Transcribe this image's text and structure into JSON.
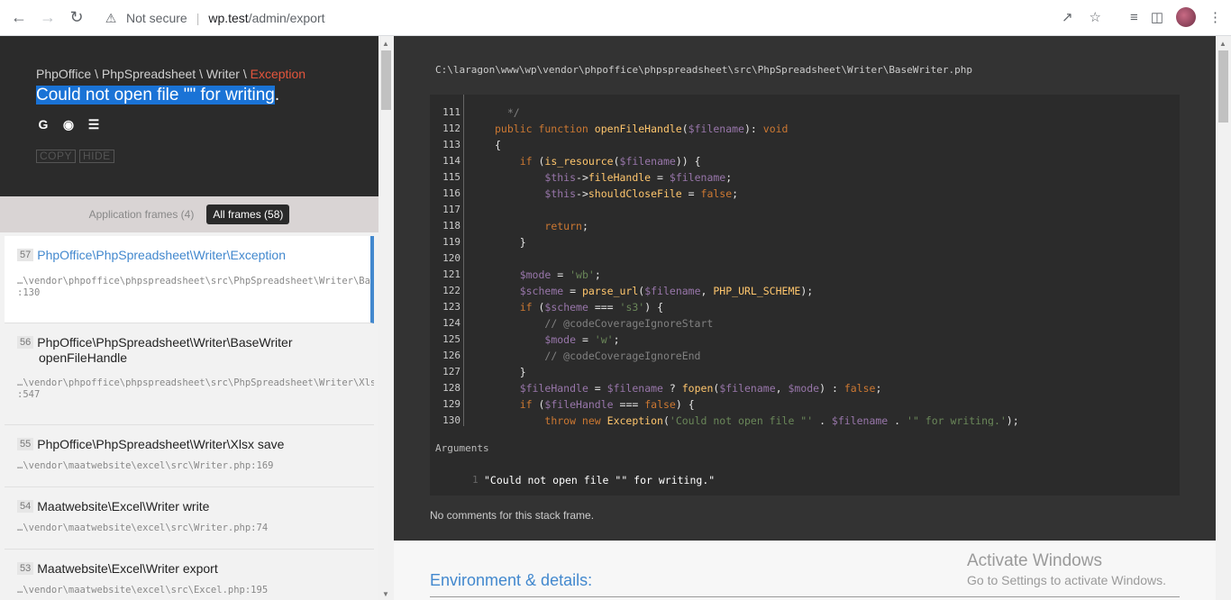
{
  "browser": {
    "not_secure": "Not secure",
    "url_host": "wp.test",
    "url_path": "/admin/export"
  },
  "exception": {
    "class_path": "PhpOffice \\ PhpSpreadsheet \\ Writer \\ ",
    "class_name": "Exception",
    "message_highlight": "Could not open file \"\" for writing",
    "message_tail": ".",
    "copy_label": "COPY",
    "hide_label": "HIDE"
  },
  "tabs": {
    "application": "Application frames (4)",
    "all": "All frames (58)"
  },
  "frames": [
    {
      "no": "57",
      "cls": "PhpOffice\\PhpSpreadsheet\\Writer\\Exception",
      "method": "",
      "file": "…\\vendor\\phpoffice\\phpspreadsheet\\src\\PhpSpreadsheet\\Writer\\BaseWriter.php",
      "line": ":130"
    },
    {
      "no": "56",
      "cls": "PhpOffice\\PhpSpreadsheet\\Writer\\BaseWriter",
      "method": "openFileHandle",
      "file": "…\\vendor\\phpoffice\\phpspreadsheet\\src\\PhpSpreadsheet\\Writer\\Xlsx.php",
      "line": ":547"
    },
    {
      "no": "55",
      "cls": "PhpOffice\\PhpSpreadsheet\\Writer\\Xlsx save",
      "method": "",
      "file": "…\\vendor\\maatwebsite\\excel\\src\\Writer.php:169",
      "line": ""
    },
    {
      "no": "54",
      "cls": "Maatwebsite\\Excel\\Writer write",
      "method": "",
      "file": "…\\vendor\\maatwebsite\\excel\\src\\Writer.php:74",
      "line": ""
    },
    {
      "no": "53",
      "cls": "Maatwebsite\\Excel\\Writer export",
      "method": "",
      "file": "…\\vendor\\maatwebsite\\excel\\src\\Excel.php:195",
      "line": ""
    }
  ],
  "code": {
    "file_path": "C:\\laragon\\www\\wp\\vendor\\phpoffice\\phpspreadsheet\\src\\PhpSpreadsheet\\Writer\\BaseWriter.php",
    "line_numbers": [
      "111",
      "112",
      "113",
      "114",
      "115",
      "116",
      "117",
      "118",
      "119",
      "120",
      "121",
      "122",
      "123",
      "124",
      "125",
      "126",
      "127",
      "128",
      "129",
      "130"
    ]
  },
  "arguments": {
    "label": "Arguments",
    "number": "1",
    "value": "\"Could not open file \"\" for writing.\""
  },
  "comments": "No comments for this stack frame.",
  "environment_title": "Environment & details:",
  "watermark": {
    "line1": "Activate Windows",
    "line2": "Go to Settings to activate Windows."
  }
}
